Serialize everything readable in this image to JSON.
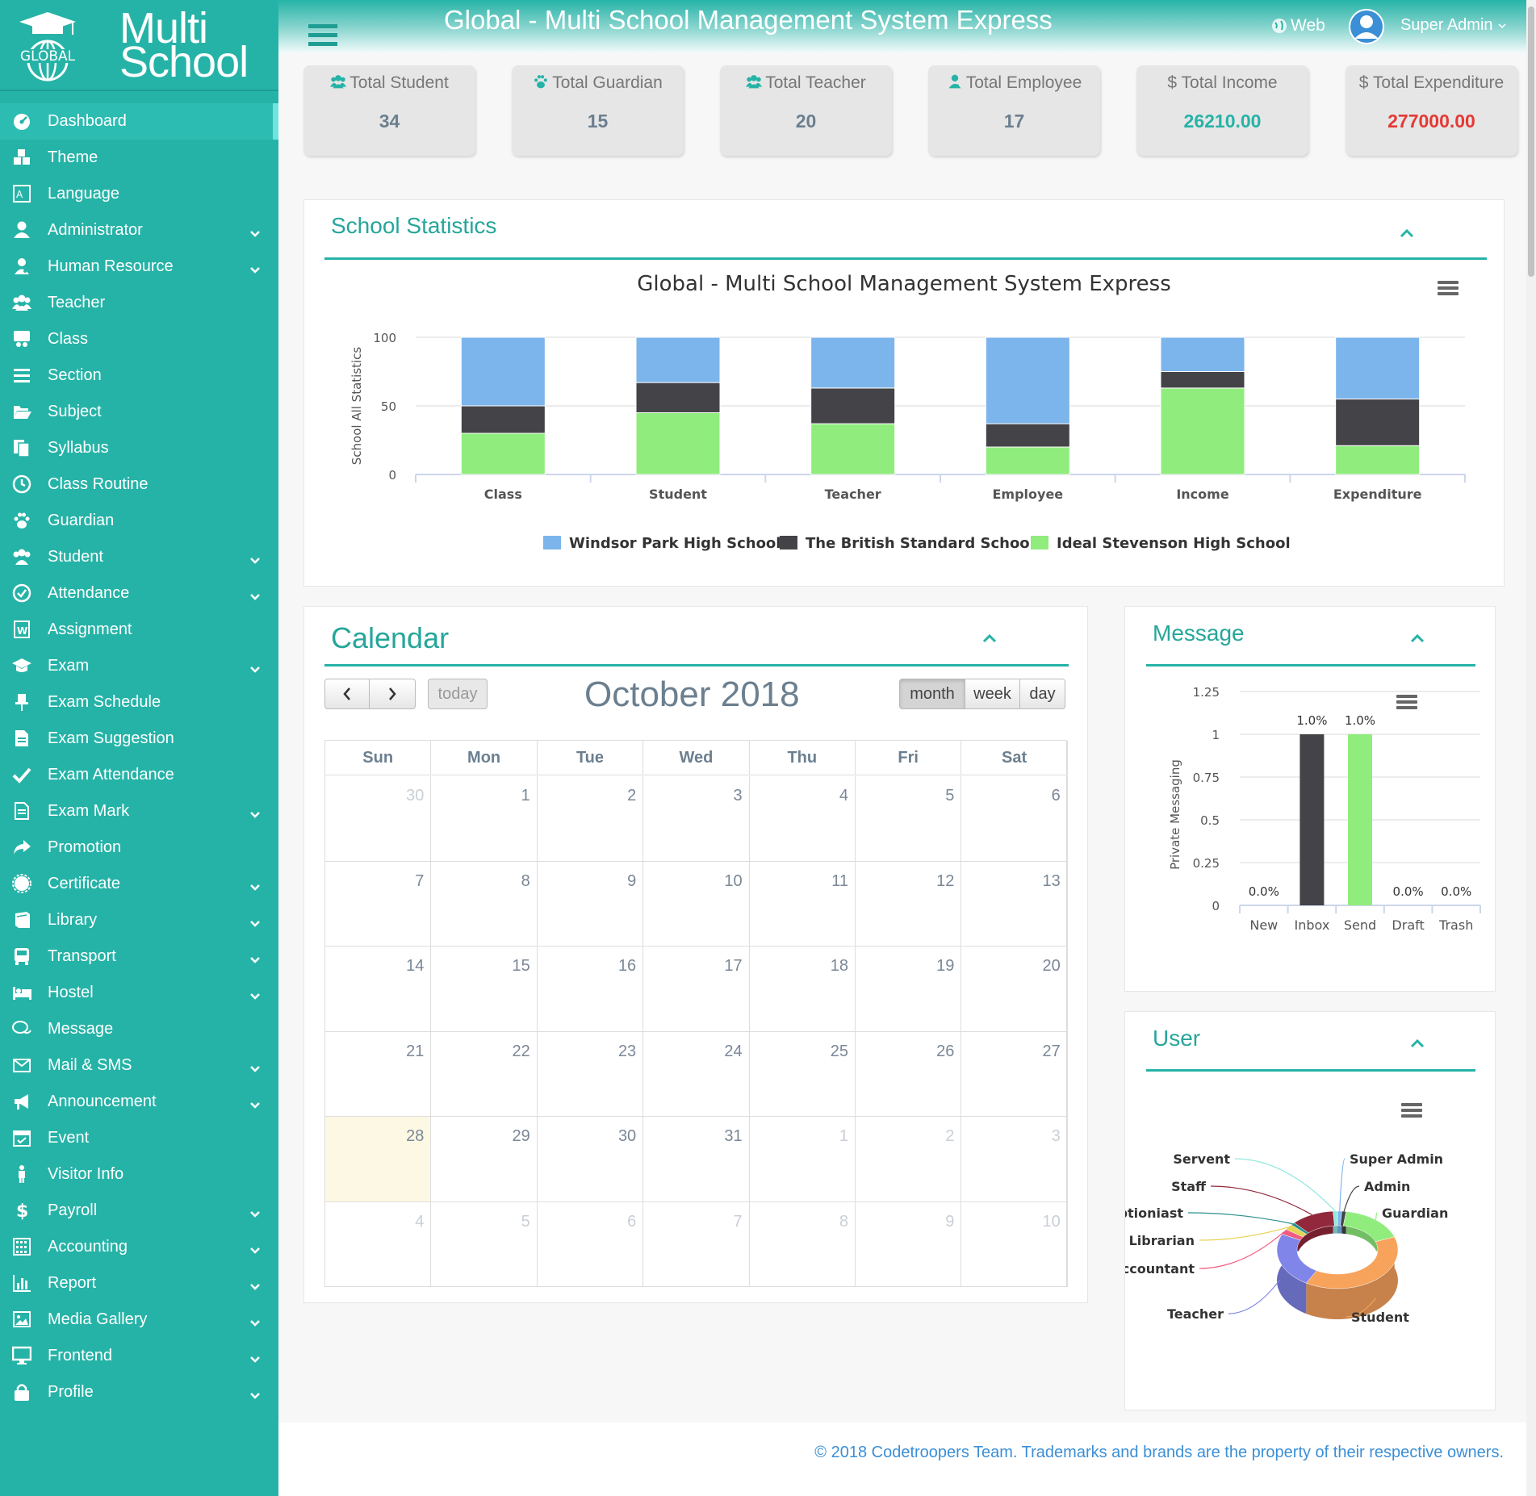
{
  "header": {
    "title": "Global - Multi School Management System Express",
    "web_label": "Web",
    "user_name": "Super Admin"
  },
  "logo": {
    "line1": "Multi",
    "line2": "School",
    "badge": "GLOBAL"
  },
  "sidebar": {
    "items": [
      {
        "label": "Dashboard",
        "icon": "dashboard-icon",
        "expandable": false
      },
      {
        "label": "Theme",
        "icon": "cubes-icon",
        "expandable": false
      },
      {
        "label": "Language",
        "icon": "language-icon",
        "expandable": false
      },
      {
        "label": "Administrator",
        "icon": "user-icon",
        "expandable": true
      },
      {
        "label": "Human Resource",
        "icon": "user-md-icon",
        "expandable": true
      },
      {
        "label": "Teacher",
        "icon": "users-icon",
        "expandable": false
      },
      {
        "label": "Class",
        "icon": "class-icon",
        "expandable": false
      },
      {
        "label": "Section",
        "icon": "bars-icon",
        "expandable": false
      },
      {
        "label": "Subject",
        "icon": "folder-open-icon",
        "expandable": false
      },
      {
        "label": "Syllabus",
        "icon": "files-icon",
        "expandable": false
      },
      {
        "label": "Class Routine",
        "icon": "clock-icon",
        "expandable": false
      },
      {
        "label": "Guardian",
        "icon": "paw-icon",
        "expandable": false
      },
      {
        "label": "Student",
        "icon": "group-icon",
        "expandable": true
      },
      {
        "label": "Attendance",
        "icon": "check-circle-icon",
        "expandable": true
      },
      {
        "label": "Assignment",
        "icon": "word-file-icon",
        "expandable": false
      },
      {
        "label": "Exam",
        "icon": "graduation-cap-icon",
        "expandable": true
      },
      {
        "label": "Exam Schedule",
        "icon": "thumb-tack-icon",
        "expandable": false
      },
      {
        "label": "Exam Suggestion",
        "icon": "file-text-icon",
        "expandable": false
      },
      {
        "label": "Exam Attendance",
        "icon": "check-icon",
        "expandable": false
      },
      {
        "label": "Exam Mark",
        "icon": "file-list-icon",
        "expandable": true
      },
      {
        "label": "Promotion",
        "icon": "share-icon",
        "expandable": false
      },
      {
        "label": "Certificate",
        "icon": "certificate-icon",
        "expandable": true
      },
      {
        "label": "Library",
        "icon": "book-icon",
        "expandable": true
      },
      {
        "label": "Transport",
        "icon": "bus-icon",
        "expandable": true
      },
      {
        "label": "Hostel",
        "icon": "bed-icon",
        "expandable": true
      },
      {
        "label": "Message",
        "icon": "comments-icon",
        "expandable": false
      },
      {
        "label": "Mail & SMS",
        "icon": "envelope-icon",
        "expandable": true
      },
      {
        "label": "Announcement",
        "icon": "bullhorn-icon",
        "expandable": true
      },
      {
        "label": "Event",
        "icon": "calendar-check-icon",
        "expandable": false
      },
      {
        "label": "Visitor Info",
        "icon": "male-icon",
        "expandable": false
      },
      {
        "label": "Payroll",
        "icon": "dollar-icon",
        "expandable": true
      },
      {
        "label": "Accounting",
        "icon": "calculator-icon",
        "expandable": true
      },
      {
        "label": "Report",
        "icon": "bar-chart-icon",
        "expandable": true
      },
      {
        "label": "Media Gallery",
        "icon": "image-icon",
        "expandable": true
      },
      {
        "label": "Frontend",
        "icon": "desktop-icon",
        "expandable": true
      },
      {
        "label": "Profile",
        "icon": "lock-icon",
        "expandable": true
      }
    ]
  },
  "stats": [
    {
      "label": "Total Student",
      "value": "34",
      "icon": "users-icon",
      "color": "#6b7f8f"
    },
    {
      "label": "Total Guardian",
      "value": "15",
      "icon": "paw-icon",
      "color": "#6b7f8f"
    },
    {
      "label": "Total Teacher",
      "value": "20",
      "icon": "users-icon",
      "color": "#6b7f8f"
    },
    {
      "label": "Total Employee",
      "value": "17",
      "icon": "user-md-icon",
      "color": "#6b7f8f"
    },
    {
      "label": "$ Total Income",
      "value": "26210.00",
      "icon": "",
      "color": "#26b3a7"
    },
    {
      "label": "$ Total Expenditure",
      "value": "277000.00",
      "icon": "",
      "color": "#e53935"
    }
  ],
  "school_stats": {
    "panel_title": "School Statistics"
  },
  "calendar": {
    "panel_title": "Calendar",
    "month_title": "October 2018",
    "today_label": "today",
    "views": [
      "month",
      "week",
      "day"
    ],
    "active_view": "month",
    "weekdays": [
      "Sun",
      "Mon",
      "Tue",
      "Wed",
      "Thu",
      "Fri",
      "Sat"
    ],
    "weeks": [
      [
        {
          "d": "30",
          "o": true
        },
        {
          "d": "1"
        },
        {
          "d": "2"
        },
        {
          "d": "3"
        },
        {
          "d": "4"
        },
        {
          "d": "5"
        },
        {
          "d": "6"
        }
      ],
      [
        {
          "d": "7"
        },
        {
          "d": "8"
        },
        {
          "d": "9"
        },
        {
          "d": "10"
        },
        {
          "d": "11"
        },
        {
          "d": "12"
        },
        {
          "d": "13"
        }
      ],
      [
        {
          "d": "14"
        },
        {
          "d": "15"
        },
        {
          "d": "16"
        },
        {
          "d": "17"
        },
        {
          "d": "18"
        },
        {
          "d": "19"
        },
        {
          "d": "20"
        }
      ],
      [
        {
          "d": "21"
        },
        {
          "d": "22"
        },
        {
          "d": "23"
        },
        {
          "d": "24"
        },
        {
          "d": "25"
        },
        {
          "d": "26"
        },
        {
          "d": "27"
        }
      ],
      [
        {
          "d": "28",
          "t": true
        },
        {
          "d": "29"
        },
        {
          "d": "30"
        },
        {
          "d": "31"
        },
        {
          "d": "1",
          "o": true
        },
        {
          "d": "2",
          "o": true
        },
        {
          "d": "3",
          "o": true
        }
      ],
      [
        {
          "d": "4",
          "o": true
        },
        {
          "d": "5",
          "o": true
        },
        {
          "d": "6",
          "o": true
        },
        {
          "d": "7",
          "o": true
        },
        {
          "d": "8",
          "o": true
        },
        {
          "d": "9",
          "o": true
        },
        {
          "d": "10",
          "o": true
        }
      ]
    ]
  },
  "message": {
    "panel_title": "Message"
  },
  "user": {
    "panel_title": "User"
  },
  "footer": {
    "text": "© 2018 Codetroopers Team. Trademarks and brands are the property of their respective owners."
  },
  "chart_data": [
    {
      "type": "bar",
      "stacked": true,
      "title": "Global - Multi School Management System Express",
      "xlabel": "",
      "ylabel": "School All Statistics",
      "ylim": [
        0,
        100
      ],
      "yticks": [
        0,
        50,
        100
      ],
      "grid": true,
      "legend_position": "bottom",
      "categories": [
        "Class",
        "Student",
        "Teacher",
        "Employee",
        "Income",
        "Expenditure"
      ],
      "series": [
        {
          "name": "Windsor Park High School",
          "color": "#7cb5ec",
          "values": [
            50,
            33,
            37,
            63,
            25,
            45
          ]
        },
        {
          "name": "The British Standard School",
          "color": "#434348",
          "values": [
            20,
            22,
            26,
            17,
            12,
            34
          ]
        },
        {
          "name": "Ideal Stevenson High School",
          "color": "#90ed7d",
          "values": [
            30,
            45,
            37,
            20,
            63,
            21
          ]
        }
      ]
    },
    {
      "type": "bar",
      "title": "",
      "xlabel": "",
      "ylabel": "Private Messaging",
      "ylim": [
        0,
        1.25
      ],
      "yticks": [
        0,
        0.25,
        0.5,
        0.75,
        1,
        1.25
      ],
      "grid": true,
      "categories": [
        "New",
        "Inbox",
        "Send",
        "Draft",
        "Trash"
      ],
      "values": [
        0,
        1,
        1,
        0,
        0
      ],
      "data_labels": [
        "0.0%",
        "1.0%",
        "1.0%",
        "0.0%",
        "0.0%"
      ],
      "colors": [
        "#7cb5ec",
        "#434348",
        "#90ed7d",
        "#f7a35c",
        "#8085e9"
      ]
    },
    {
      "type": "pie",
      "donut": true,
      "three_d": true,
      "title": "",
      "slices": [
        {
          "label": "Super Admin",
          "value": 1,
          "color": "#7cb5ec"
        },
        {
          "label": "Admin",
          "value": 1,
          "color": "#434348"
        },
        {
          "label": "Guardian",
          "value": 15,
          "color": "#90ed7d"
        },
        {
          "label": "Student",
          "value": 34,
          "color": "#f7a35c"
        },
        {
          "label": "Teacher",
          "value": 20,
          "color": "#8085e9"
        },
        {
          "label": "Accountant",
          "value": 2,
          "color": "#f15c80"
        },
        {
          "label": "Librarian",
          "value": 2,
          "color": "#e4d354"
        },
        {
          "label": "Receptioniast",
          "value": 1,
          "color": "#2b908f"
        },
        {
          "label": "Staff",
          "value": 10,
          "color": "#91283b"
        },
        {
          "label": "Servent",
          "value": 1,
          "color": "#91e8e1"
        }
      ]
    }
  ]
}
